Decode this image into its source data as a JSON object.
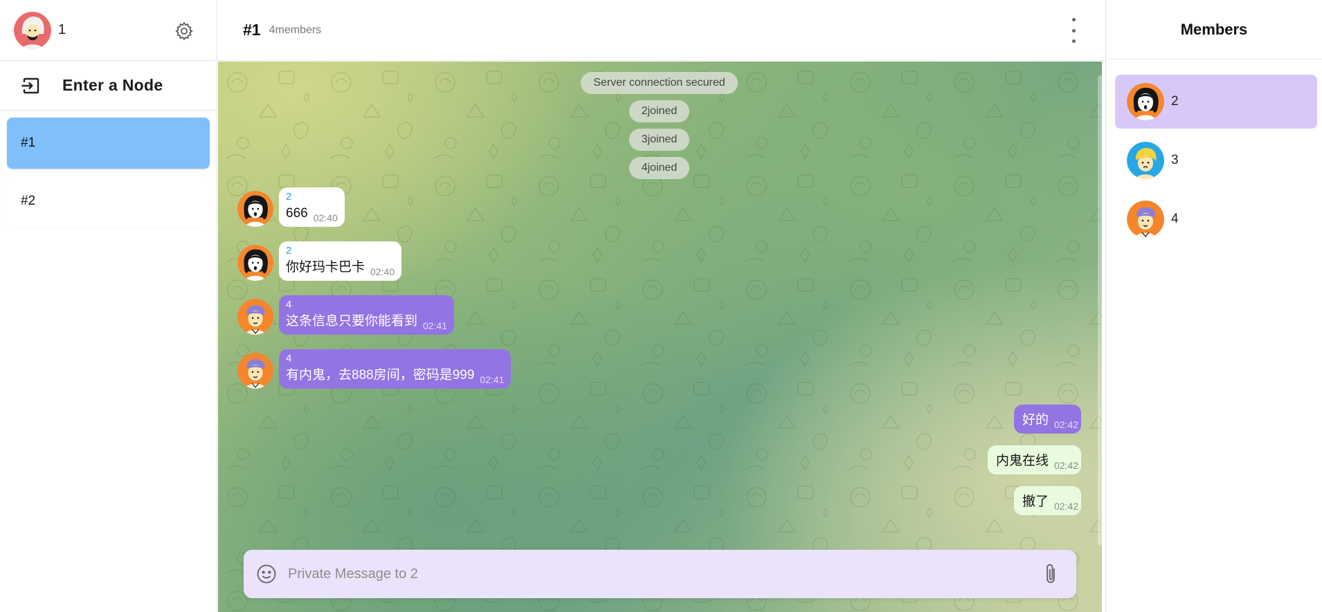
{
  "sidebar": {
    "user_name": "1",
    "enter_node_label": "Enter a Node",
    "nodes": [
      {
        "label": "#1",
        "active": true
      },
      {
        "label": "#2",
        "active": false
      }
    ]
  },
  "chat": {
    "title": "#1",
    "members_count": "4members",
    "system_messages": [
      "Server connection secured",
      "2joined",
      "3joined",
      "4joined"
    ],
    "messages": [
      {
        "sender": "2",
        "text": "666",
        "time": "02:40"
      },
      {
        "sender": "2",
        "text": "你好玛卡巴卡",
        "time": "02:40"
      },
      {
        "sender": "4",
        "text": "这条信息只要你能看到",
        "time": "02:41"
      },
      {
        "sender": "4",
        "text": "有内鬼，去888房间，密码是999",
        "time": "02:41"
      }
    ],
    "outgoing": [
      {
        "text": "好的",
        "time": "02:42"
      },
      {
        "text": "内鬼在线",
        "time": "02:42"
      },
      {
        "text": "撤了",
        "time": "02:42"
      }
    ],
    "composer": {
      "placeholder": "Private Message to 2"
    }
  },
  "members_panel": {
    "title": "Members",
    "members": [
      {
        "name": "2",
        "active": true
      },
      {
        "name": "3",
        "active": false
      },
      {
        "name": "4",
        "active": false
      }
    ]
  },
  "colors": {
    "active_node": "#7fbffa",
    "private_bubble": "#9473e3",
    "own_bubble": "#e9fbde",
    "composer_bg": "#ebe3fb",
    "active_member": "#d8c8f7"
  }
}
